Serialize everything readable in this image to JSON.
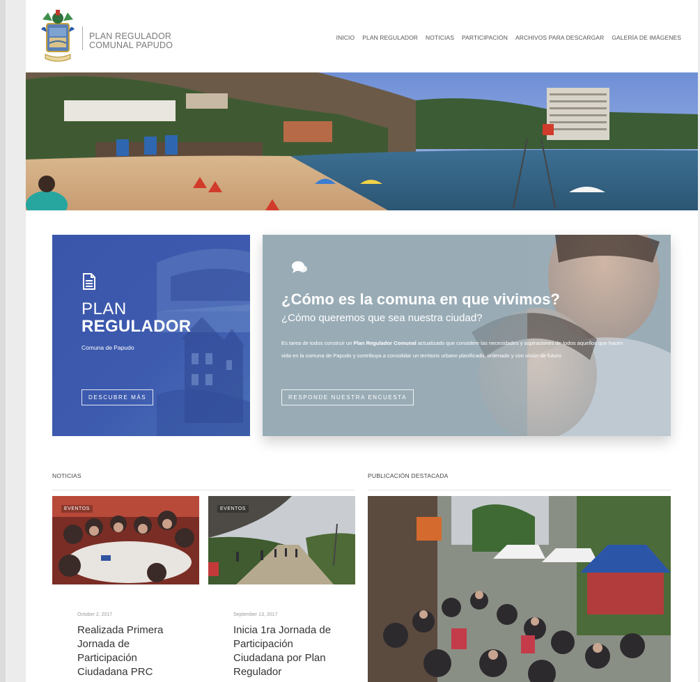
{
  "brand": {
    "line1": "PLAN REGULADOR",
    "line2": "COMUNAL PAPUDO"
  },
  "nav": [
    {
      "label": "INICIO"
    },
    {
      "label": "PLAN REGULADOR"
    },
    {
      "label": "NOTICIAS"
    },
    {
      "label": "PARTICIPACIÓN"
    },
    {
      "label": "ARCHIVOS PARA DESCARGAR"
    },
    {
      "label": "GALERÍA DE IMÁGENES"
    }
  ],
  "plan_card": {
    "title_line1": "PLAN",
    "title_line2": "REGULADOR",
    "subtitle": "Comuna de Papudo",
    "button": "DESCUBRE MÁS",
    "icon": "document-icon"
  },
  "survey_card": {
    "icon": "chat-bubbles-icon",
    "title": "¿Cómo es la comuna en que vivimos?",
    "subtitle": "¿Cómo queremos que sea nuestra ciudad?",
    "body_before": "Es tarea de todos construir un ",
    "body_bold": "Plan Regulador Comunal",
    "body_after": " actualizado que considere las necesidades y aspiraciones de todos aquellos que hacen vida en la comuna de Papudo y contribuya a consolidar un territorio urbano planificado, ordenado y con visión de futuro.",
    "button": "RESPONDE NUESTRA ENCUESTA"
  },
  "news": {
    "section_title": "NOTICIAS",
    "items": [
      {
        "tag": "EVENTOS",
        "date": "October 2, 2017",
        "title": "Realizada Primera Jornada de Participación Ciudadana PRC"
      },
      {
        "tag": "EVENTOS",
        "date": "September 13, 2017",
        "title": "Inicia 1ra Jornada de Participación Ciudadana por Plan Regulador"
      }
    ]
  },
  "featured": {
    "section_title": "PUBLICACIÓN DESTACADA"
  },
  "colors": {
    "plan_blue": "#3d5aae",
    "survey_gray": "#98aab4",
    "nav_text": "#555555"
  }
}
